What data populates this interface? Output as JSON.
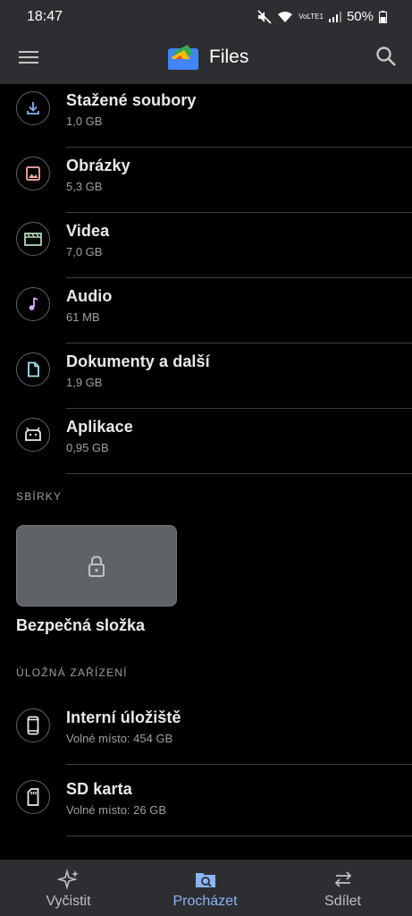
{
  "status_bar": {
    "time": "18:47",
    "battery": "50%",
    "network": "VoLTE1"
  },
  "app_bar": {
    "title": "Files"
  },
  "categories": [
    {
      "label": "Stažené soubory",
      "size": "1,0 GB",
      "icon": "download-icon"
    },
    {
      "label": "Obrázky",
      "size": "5,3 GB",
      "icon": "image-icon"
    },
    {
      "label": "Videa",
      "size": "7,0 GB",
      "icon": "video-icon"
    },
    {
      "label": "Audio",
      "size": "61 MB",
      "icon": "music-note-icon"
    },
    {
      "label": "Dokumenty a další",
      "size": "1,9 GB",
      "icon": "document-icon"
    },
    {
      "label": "Aplikace",
      "size": "0,95 GB",
      "icon": "android-icon"
    }
  ],
  "collections": {
    "heading": "SBÍRKY",
    "safe_folder_label": "Bezpečná složka"
  },
  "storage": {
    "heading": "ÚLOŽNÁ ZAŘÍZENÍ",
    "devices": [
      {
        "label": "Interní úložiště",
        "free": "Volné místo: 454 GB",
        "icon": "phone-icon"
      },
      {
        "label": "SD karta",
        "free": "Volné místo: 26 GB",
        "icon": "sd-card-icon"
      }
    ]
  },
  "bottom_nav": {
    "items": [
      {
        "label": "Vyčistit",
        "icon": "sparkle-icon",
        "active": false
      },
      {
        "label": "Procházet",
        "icon": "browse-icon",
        "active": true
      },
      {
        "label": "Sdílet",
        "icon": "swap-icon",
        "active": false
      }
    ]
  },
  "colors": {
    "app_bar": "#2d2e31",
    "background": "#000000",
    "accent": "#8ab4f8"
  }
}
